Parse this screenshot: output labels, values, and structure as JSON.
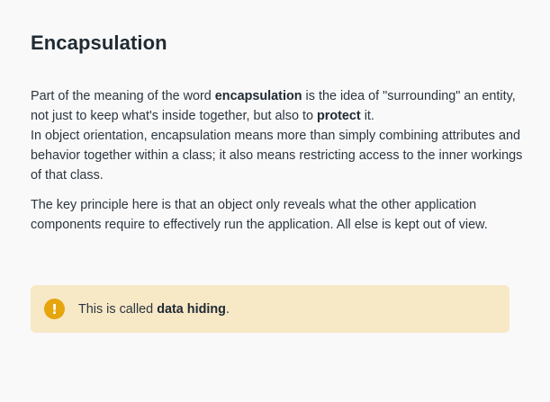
{
  "article": {
    "title": "Encapsulation",
    "para1": {
      "s1": "Part of the meaning of the word ",
      "b1": "encapsulation",
      "s2": " is the idea of \"surrounding\" an entity, not just to keep what's inside together, but also to ",
      "b2": "protect",
      "s3": " it.",
      "s4": "In object orientation, encapsulation means more than simply combining attributes and behavior together within a class; it also means restricting access to the inner workings of that class."
    },
    "para2": "The key principle here is that an object only reveals what the other application components require to effectively run the application. All else is kept out of view."
  },
  "callout": {
    "icon": "exclamation-icon",
    "icon_glyph": "!",
    "prefix": "This is called ",
    "bold": "data hiding",
    "suffix": ".",
    "background_color": "#f7e8c6",
    "icon_color": "#e6a50d"
  }
}
